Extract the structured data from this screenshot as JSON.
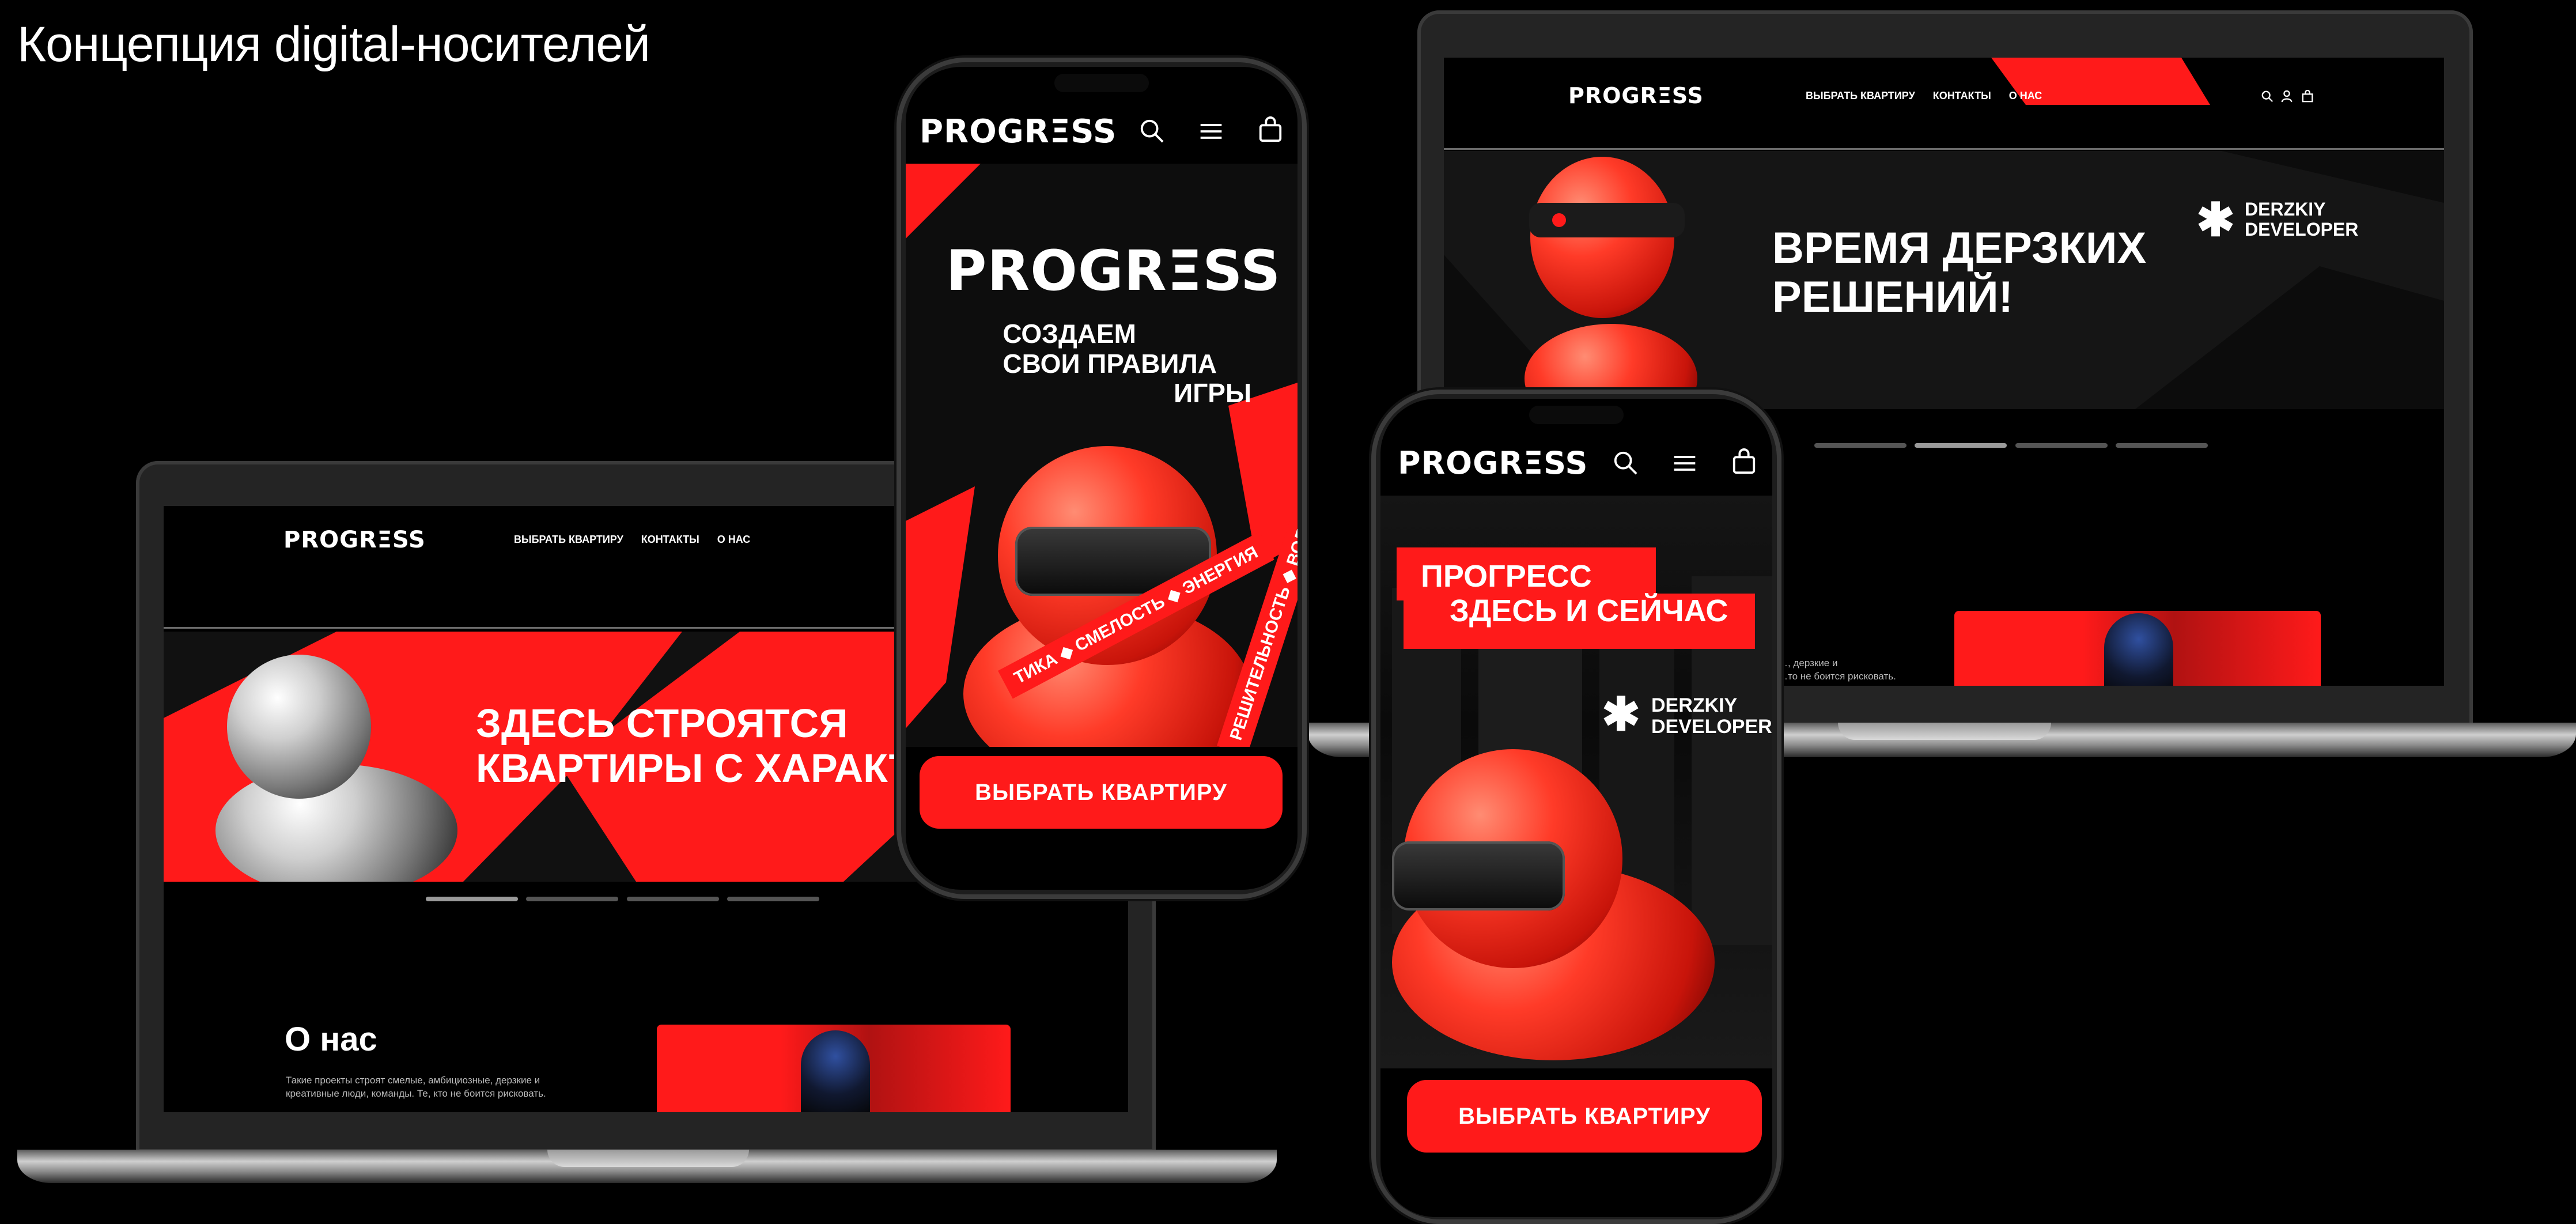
{
  "page": {
    "title": "Концепция digital-носителей"
  },
  "site": {
    "logo": "PROGRΞSS",
    "nav": [
      "ВЫБРАТЬ КВАРТИРУ",
      "КОНТАКТЫ",
      "О НАС"
    ],
    "cta": "ВЫБРАТЬ КВАРТИРУ",
    "brand_mark": "DERZKIY\nDEVELOPER",
    "brand_line1": "DERZKIY",
    "brand_line2": "DEVELOPER"
  },
  "laptop_left": {
    "hero_line1": "ЗДЕСЬ СТРОЯТСЯ",
    "hero_line2": "КВАРТИРЫ С ХАРАКТ",
    "about_title": "О нас",
    "about_text_line1": "Такие проекты строят смелые, амбициозные, дерзкие и",
    "about_text_line2": "креативные люди, команды. Те, кто не боится рисковать.",
    "slider_count": 4,
    "slider_active": 0
  },
  "laptop_right": {
    "hero_line1": "ВРЕМЯ ДЕРЗКИХ",
    "hero_line2": "РЕШЕНИЙ!",
    "about_text_line1": "…, дерзкие и",
    "about_text_line2": "…то не боится рисковать.",
    "slider_count": 4,
    "slider_active": 1
  },
  "phone_left": {
    "hero_logo": "PROGRΞSS",
    "slogan_line1": "СОЗДАЕМ",
    "slogan_line2": "СВОИ ПРАВИЛА",
    "slogan_line3": "ИГРЫ",
    "ribbon1": "ТИКА ◆ СМЕЛОСТЬ ◆ ЭНЕРГИЯ",
    "ribbon2": "РЕШИТЕЛЬНОСТЬ ◆ ВОЛЯ ◆ СМЕЛОСТЬ"
  },
  "phone_right": {
    "hero_line1": "ПРОГРЕСС",
    "hero_line2": "ЗДЕСЬ И СЕЙЧАС"
  },
  "icons": [
    "search-icon",
    "menu-icon",
    "bag-icon",
    "user-icon",
    "asterisk-icon"
  ],
  "colors": {
    "accent": "#ff1a1a",
    "background": "#000000"
  }
}
